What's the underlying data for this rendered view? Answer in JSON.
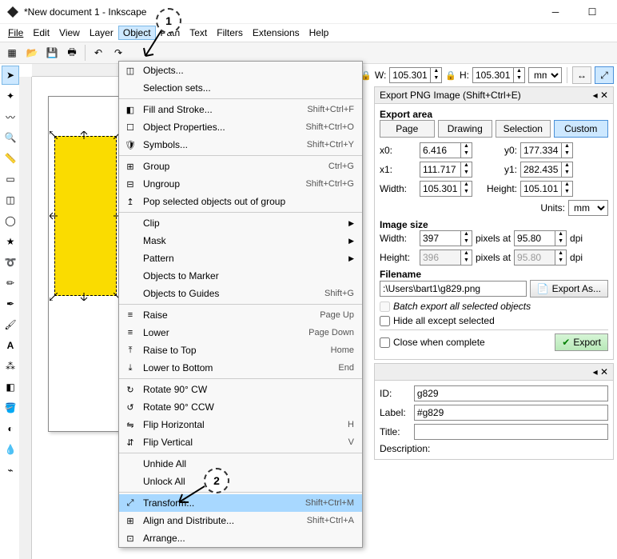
{
  "window": {
    "title": "*New document 1 - Inkscape"
  },
  "menubar": [
    "File",
    "Edit",
    "View",
    "Layer",
    "Object",
    "Path",
    "Text",
    "Filters",
    "Extensions",
    "Help"
  ],
  "menubar_open_index": 4,
  "toolbar_right": {
    "w_label": "W:",
    "w": "105.301",
    "h_label": "H:",
    "h": "105.301",
    "unit": "mm"
  },
  "callouts": {
    "one": "1",
    "two": "2"
  },
  "object_menu": [
    {
      "type": "item",
      "icon": "◫",
      "label": "Objects...",
      "shortcut": ""
    },
    {
      "type": "item",
      "icon": "",
      "label": "Selection sets...",
      "shortcut": ""
    },
    {
      "type": "sep"
    },
    {
      "type": "item",
      "icon": "◧",
      "label": "Fill and Stroke...",
      "shortcut": "Shift+Ctrl+F"
    },
    {
      "type": "item",
      "icon": "☐",
      "label": "Object Properties...",
      "shortcut": "Shift+Ctrl+O"
    },
    {
      "type": "item",
      "icon": "🛡",
      "label": "Symbols...",
      "shortcut": "Shift+Ctrl+Y"
    },
    {
      "type": "sep"
    },
    {
      "type": "item",
      "icon": "⊞",
      "label": "Group",
      "shortcut": "Ctrl+G"
    },
    {
      "type": "item",
      "icon": "⊟",
      "label": "Ungroup",
      "shortcut": "Shift+Ctrl+G"
    },
    {
      "type": "item",
      "icon": "↥",
      "label": "Pop selected objects out of group",
      "shortcut": ""
    },
    {
      "type": "sep"
    },
    {
      "type": "sub",
      "icon": "",
      "label": "Clip"
    },
    {
      "type": "sub",
      "icon": "",
      "label": "Mask"
    },
    {
      "type": "sub",
      "icon": "",
      "label": "Pattern"
    },
    {
      "type": "item",
      "icon": "",
      "label": "Objects to Marker",
      "shortcut": ""
    },
    {
      "type": "item",
      "icon": "",
      "label": "Objects to Guides",
      "shortcut": "Shift+G"
    },
    {
      "type": "sep"
    },
    {
      "type": "item",
      "icon": "≡",
      "label": "Raise",
      "shortcut": "Page Up"
    },
    {
      "type": "item",
      "icon": "≡",
      "label": "Lower",
      "shortcut": "Page Down"
    },
    {
      "type": "item",
      "icon": "⤒",
      "label": "Raise to Top",
      "shortcut": "Home"
    },
    {
      "type": "item",
      "icon": "⤓",
      "label": "Lower to Bottom",
      "shortcut": "End"
    },
    {
      "type": "sep"
    },
    {
      "type": "item",
      "icon": "↻",
      "label": "Rotate 90° CW",
      "shortcut": ""
    },
    {
      "type": "item",
      "icon": "↺",
      "label": "Rotate 90° CCW",
      "shortcut": ""
    },
    {
      "type": "item",
      "icon": "⇋",
      "label": "Flip Horizontal",
      "shortcut": "H"
    },
    {
      "type": "item",
      "icon": "⇵",
      "label": "Flip Vertical",
      "shortcut": "V"
    },
    {
      "type": "sep"
    },
    {
      "type": "item",
      "icon": "",
      "label": "Unhide All",
      "shortcut": ""
    },
    {
      "type": "item",
      "icon": "",
      "label": "Unlock All",
      "shortcut": ""
    },
    {
      "type": "sep"
    },
    {
      "type": "item",
      "icon": "⤢",
      "label": "Transform...",
      "shortcut": "Shift+Ctrl+M",
      "hl": true
    },
    {
      "type": "item",
      "icon": "⊞",
      "label": "Align and Distribute...",
      "shortcut": "Shift+Ctrl+A"
    },
    {
      "type": "item",
      "icon": "⊡",
      "label": "Arrange...",
      "shortcut": ""
    }
  ],
  "export_panel": {
    "title": "Export PNG Image (Shift+Ctrl+E)",
    "area_label": "Export area",
    "tabs": [
      "Page",
      "Drawing",
      "Selection",
      "Custom"
    ],
    "active_tab": 3,
    "x0_l": "x0:",
    "x0": "6.416",
    "y0_l": "y0:",
    "y0": "177.334",
    "x1_l": "x1:",
    "x1": "111.717",
    "y1_l": "y1:",
    "y1": "282.435",
    "w_l": "Width:",
    "w": "105.301",
    "h_l": "Height:",
    "h": "105.101",
    "units_l": "Units:",
    "units": "mm",
    "imgsize_l": "Image size",
    "iw_l": "Width:",
    "iw": "397",
    "px_l": "pixels at",
    "dpi1": "95.80",
    "dpi_l": "dpi",
    "ih_l": "Height:",
    "ih": "396",
    "dpi2": "95.80",
    "fname_l": "Filename",
    "fname": ":\\Users\\bart1\\g829.png",
    "export_as": "Export As...",
    "batch": "Batch export all selected objects",
    "hide": "Hide all except selected",
    "close": "Close when complete",
    "export": "Export"
  },
  "objprops": {
    "title": "",
    "id_l": "ID:",
    "id": "g829",
    "label_l": "Label:",
    "label": "#g829",
    "title_l": "Title:",
    "desc_l": "Description:"
  }
}
